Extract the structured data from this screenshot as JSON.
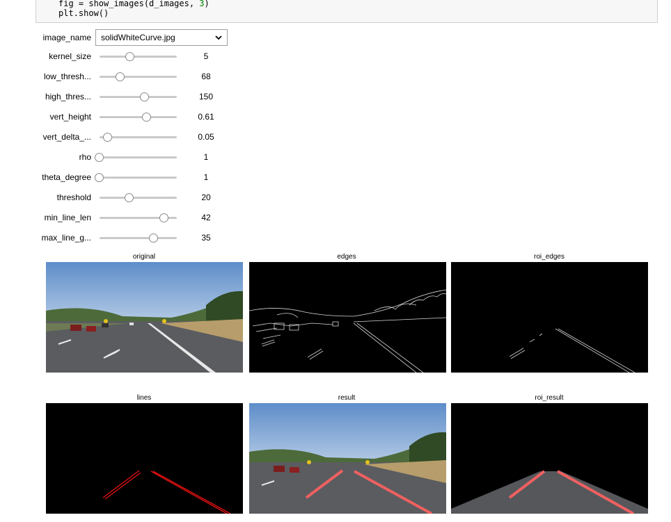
{
  "code": {
    "line1_prefix": "fig = show_images(d_images, ",
    "line1_num": "3",
    "line1_suffix": ")",
    "line2": "plt.show()"
  },
  "dropdown": {
    "label": "image_name",
    "value": "solidWhiteCurve.jpg",
    "chevron_icon": "chevron-down-icon"
  },
  "sliders": [
    {
      "label": "kernel_size",
      "value": "5",
      "fraction": 0.4
    },
    {
      "label": "low_thresh...",
      "value": "68",
      "fraction": 0.27
    },
    {
      "label": "high_thres...",
      "value": "150",
      "fraction": 0.59
    },
    {
      "label": "vert_height",
      "value": "0.61",
      "fraction": 0.61
    },
    {
      "label": "vert_delta_...",
      "value": "0.05",
      "fraction": 0.11
    },
    {
      "label": "rho",
      "value": "1",
      "fraction": 0.0
    },
    {
      "label": "theta_degree",
      "value": "1",
      "fraction": 0.0
    },
    {
      "label": "threshold",
      "value": "20",
      "fraction": 0.39
    },
    {
      "label": "min_line_len",
      "value": "42",
      "fraction": 0.84
    },
    {
      "label": "max_line_g...",
      "value": "35",
      "fraction": 0.7
    }
  ],
  "figure": {
    "titles": [
      "original",
      "edges",
      "roi_edges",
      "lines",
      "result",
      "roi_result"
    ]
  },
  "colors": {
    "lane_red": "#e01010",
    "sky": "#6f9bd0",
    "road": "#585a5e"
  }
}
